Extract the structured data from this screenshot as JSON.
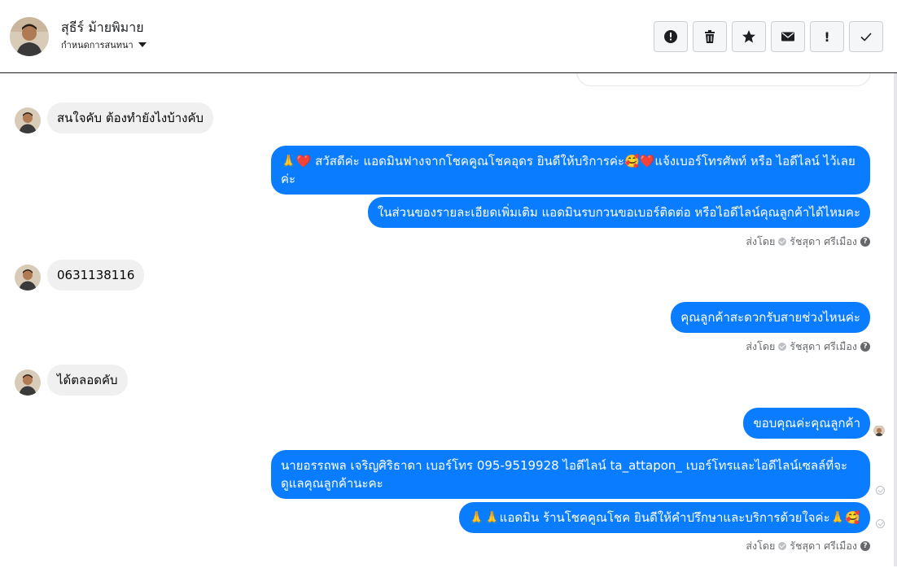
{
  "header": {
    "contact_name": "สุธีร์ ม้ายพิมาย",
    "assign_label": "กำหนดการสนทนา"
  },
  "toolbar": {
    "icons": [
      "alert-circle-icon",
      "trash-icon",
      "star-icon",
      "envelope-icon",
      "exclamation-icon",
      "check-icon"
    ]
  },
  "messages": [
    {
      "from": "customer",
      "text": "สนใจคับ ต้องทำยังไงบ้างคับ"
    },
    {
      "from": "page",
      "text": "🙏❤️ สวัสดีค่ะ แอดมินฟางจากโชคคูณโชคอุดร ยินดีให้บริการค่ะ🥰❤️แจ้งเบอร์โทรศัพท์ หรือ ไอดีไลน์  ไว้เลยค่ะ"
    },
    {
      "from": "page",
      "text": "ในส่วนของรายละเอียดเพิ่มเติม แอดมินรบกวนขอเบอร์ติดต่อ หรือไอดีไลน์คุณลูกค้าได้ไหมคะ"
    },
    {
      "from": "customer",
      "text": "0631138116"
    },
    {
      "from": "page",
      "text": "คุณลูกค้าสะดวกรับสายช่วงไหนค่ะ"
    },
    {
      "from": "customer",
      "text": "ได้ตลอดคับ"
    },
    {
      "from": "page",
      "text": "ขอบคุณค่ะคุณลูกค้า"
    },
    {
      "from": "page",
      "text": "นายอรรถพล เจริญศิริธาดา     เบอร์โทร 095-9519928 ไอดีไลน์ ta_attapon_   เบอร์โทรและไอดีไลน์เซลล์ที่จะดูแลคุณลูกค้านะคะ"
    },
    {
      "from": "page",
      "text": "🙏🙏แอดมิน ร้านโชคคูณโชค ยินดีให้คำปรึกษาและบริการด้วยใจค่ะ🙏🥰"
    }
  ],
  "sent_by": {
    "prefix": "ส่งโดย",
    "agent": "รัชสุดา ศรีเมือง",
    "help": "?"
  },
  "colors": {
    "outgoing_bubble": "#0a7cff",
    "incoming_bubble": "#f0f0f0"
  }
}
